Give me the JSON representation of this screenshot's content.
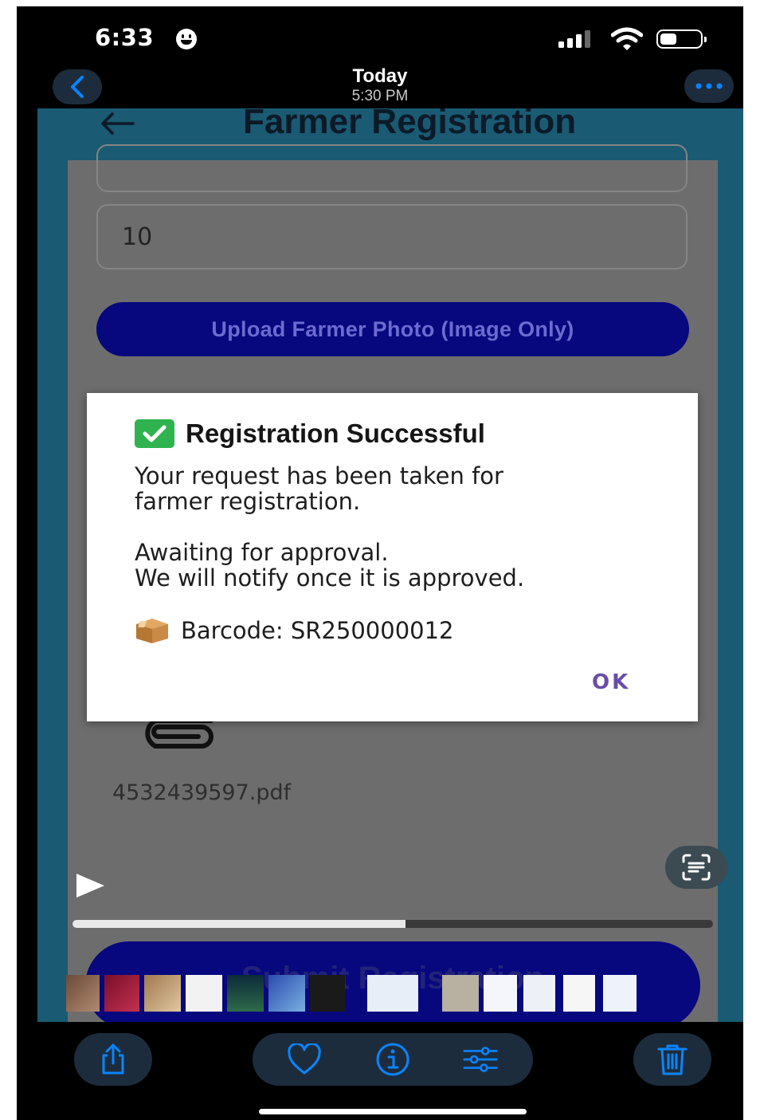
{
  "status_bar": {
    "time": "6:33"
  },
  "viewer_header": {
    "title": "Today",
    "subtitle": "5:30 PM"
  },
  "app": {
    "title": "Farmer Registration",
    "field_value": "10",
    "upload_button_label": "Upload Farmer Photo (Image Only)",
    "attached_file_name": "4532439597.pdf",
    "submit_button_label": "Submit Registration"
  },
  "dialog": {
    "title": "Registration Successful",
    "body_line_1": "Your request has been taken for",
    "body_line_2": "farmer registration.",
    "body_line_3": "Awaiting for approval.",
    "body_line_4": "We will notify once it is approved.",
    "barcode_text": "Barcode: SR250000012",
    "ok_label": "OK"
  },
  "video": {
    "progress": 0.52
  },
  "colors": {
    "app_header": "#1a5a73",
    "primary_button": "#07077e",
    "dialog_accent": "#6a4ca8",
    "ios_accent": "#0a84ff"
  },
  "icons": [
    "back-chevron-icon",
    "more-icon",
    "share-icon",
    "heart-icon",
    "info-icon",
    "adjust-icon",
    "trash-icon",
    "play-icon",
    "live-text-icon",
    "paperclip-icon",
    "check-icon",
    "package-icon"
  ]
}
